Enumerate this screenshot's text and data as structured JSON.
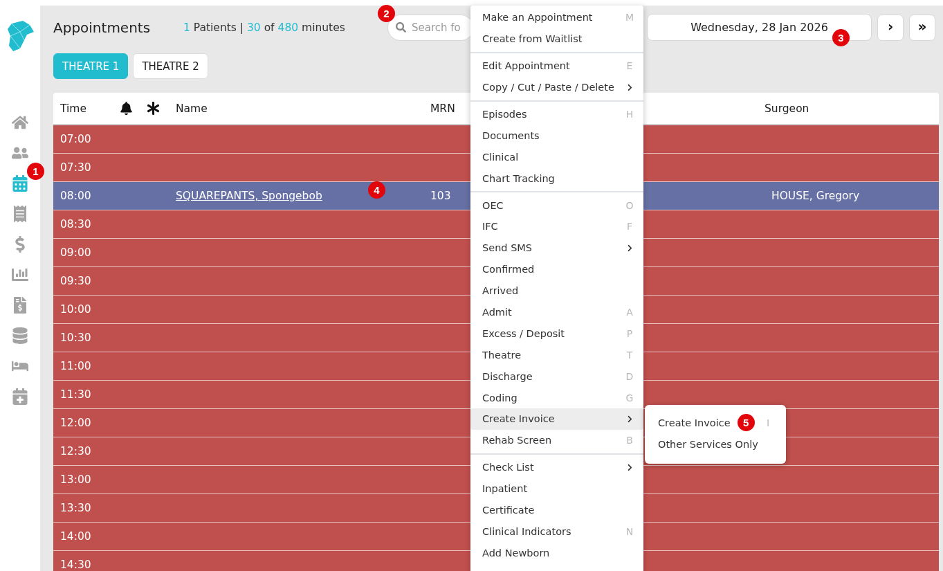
{
  "sidebar": {
    "items": [
      {
        "kind": "home",
        "selected": false
      },
      {
        "kind": "users",
        "selected": false
      },
      {
        "kind": "calendar",
        "selected": true,
        "marker": "1"
      },
      {
        "kind": "receipt",
        "selected": false
      },
      {
        "kind": "dollar",
        "selected": false
      },
      {
        "kind": "chart",
        "selected": false
      },
      {
        "kind": "invoice",
        "selected": false
      },
      {
        "kind": "database",
        "selected": false
      },
      {
        "kind": "bed",
        "selected": false
      },
      {
        "kind": "planner",
        "selected": false
      }
    ]
  },
  "header": {
    "title": "Appointments",
    "stats": {
      "patients": "1",
      "patients_label": "Patients |",
      "used": "30",
      "of": "of",
      "total": "480",
      "unit": "minutes"
    },
    "search": {
      "placeholder": "Search fo",
      "marker": "2"
    },
    "date": {
      "value": "Wednesday, 28 Jan 2026",
      "marker": "3"
    },
    "nav_buttons": [
      {
        "label": "›"
      },
      {
        "label": "»"
      }
    ]
  },
  "tabs": [
    {
      "label": "THEATRE 1",
      "selected": true
    },
    {
      "label": "THEATRE 2",
      "selected": false
    }
  ],
  "table": {
    "columns": [
      {
        "kind": "text",
        "label": "Time"
      },
      {
        "kind": "bell"
      },
      {
        "kind": "asterisk"
      },
      {
        "kind": "text",
        "label": "Name"
      },
      {
        "kind": "text",
        "label": "MRN"
      },
      {
        "kind": "text",
        "label": "Surgeon"
      }
    ],
    "rows": [
      {
        "time": "07:00",
        "selected": false
      },
      {
        "time": "07:30",
        "selected": false
      },
      {
        "time": "08:00",
        "selected": true,
        "name": "SQUAREPANTS, Spongebob",
        "mrn": "103",
        "surgeon": "HOUSE, Gregory",
        "marker": "4"
      },
      {
        "time": "08:30",
        "selected": false
      },
      {
        "time": "09:00",
        "selected": false
      },
      {
        "time": "09:30",
        "selected": false
      },
      {
        "time": "10:00",
        "selected": false
      },
      {
        "time": "10:30",
        "selected": false
      },
      {
        "time": "11:00",
        "selected": false
      },
      {
        "time": "11:30",
        "selected": false
      },
      {
        "time": "12:00",
        "selected": false
      },
      {
        "time": "12:30",
        "selected": false
      },
      {
        "time": "13:00",
        "selected": false
      },
      {
        "time": "13:30",
        "selected": false
      },
      {
        "time": "14:00",
        "selected": false
      },
      {
        "time": "14:30",
        "selected": false
      }
    ]
  },
  "context_menu": {
    "groups": [
      {
        "items": [
          {
            "kind": "action",
            "label": "Make an Appointment",
            "shortcut": "M",
            "selected": false
          },
          {
            "kind": "action",
            "label": "Create from Waitlist",
            "selected": false
          }
        ]
      },
      {
        "items": [
          {
            "kind": "action",
            "label": "Edit Appointment",
            "shortcut": "E",
            "selected": false
          },
          {
            "kind": "submenu",
            "label": "Copy / Cut / Paste / Delete",
            "selected": false
          }
        ]
      },
      {
        "items": [
          {
            "kind": "action",
            "label": "Episodes",
            "shortcut": "H",
            "selected": false
          },
          {
            "kind": "action",
            "label": "Documents",
            "selected": false
          },
          {
            "kind": "action",
            "label": "Clinical",
            "selected": false
          },
          {
            "kind": "action",
            "label": "Chart Tracking",
            "selected": false
          }
        ]
      },
      {
        "items": [
          {
            "kind": "action",
            "label": "OEC",
            "shortcut": "O",
            "selected": false
          },
          {
            "kind": "action",
            "label": "IFC",
            "shortcut": "F",
            "selected": false
          },
          {
            "kind": "submenu",
            "label": "Send SMS",
            "selected": false
          },
          {
            "kind": "action",
            "label": "Confirmed",
            "selected": false
          },
          {
            "kind": "action",
            "label": "Arrived",
            "selected": false
          },
          {
            "kind": "action",
            "label": "Admit",
            "shortcut": "A",
            "selected": false
          },
          {
            "kind": "action",
            "label": "Excess / Deposit",
            "shortcut": "P",
            "selected": false
          },
          {
            "kind": "action",
            "label": "Theatre",
            "shortcut": "T",
            "selected": false
          },
          {
            "kind": "action",
            "label": "Discharge",
            "shortcut": "D",
            "selected": false
          },
          {
            "kind": "action",
            "label": "Coding",
            "shortcut": "G",
            "selected": false
          },
          {
            "kind": "submenu",
            "label": "Create Invoice",
            "selected": true,
            "submenu": [
              {
                "label": "Create Invoice",
                "shortcut": "I",
                "marker": "5"
              },
              {
                "label": "Other Services Only"
              }
            ]
          },
          {
            "kind": "action",
            "label": "Rehab Screen",
            "shortcut": "B",
            "selected": false
          }
        ]
      },
      {
        "items": [
          {
            "kind": "submenu",
            "label": "Check List",
            "selected": false
          },
          {
            "kind": "action",
            "label": "Inpatient",
            "selected": false
          },
          {
            "kind": "action",
            "label": "Certificate",
            "selected": false
          },
          {
            "kind": "action",
            "label": "Clinical Indicators",
            "shortcut": "N",
            "selected": false
          },
          {
            "kind": "action",
            "label": "Add Newborn",
            "selected": false
          }
        ]
      }
    ]
  }
}
